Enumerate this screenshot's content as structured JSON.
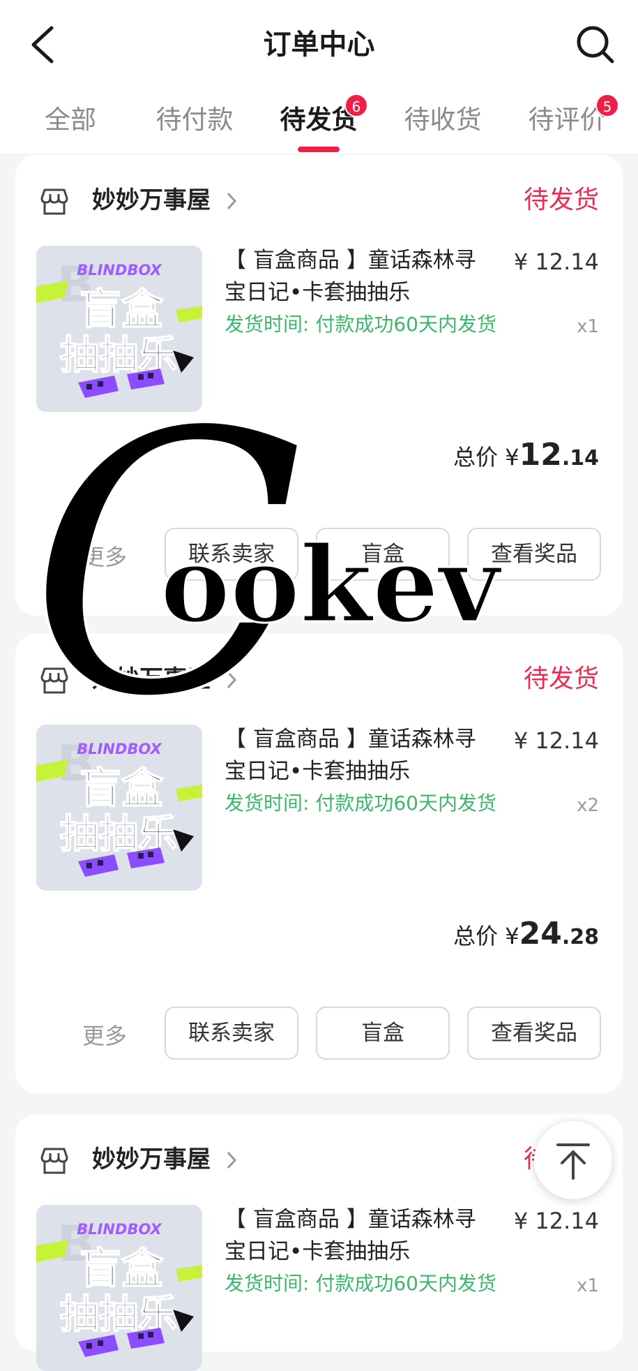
{
  "header": {
    "title": "订单中心"
  },
  "tabs": [
    {
      "label": "全部",
      "badge": ""
    },
    {
      "label": "待付款",
      "badge": ""
    },
    {
      "label": "待发货",
      "badge": "6"
    },
    {
      "label": "待收货",
      "badge": ""
    },
    {
      "label": "待评价",
      "badge": "5"
    }
  ],
  "thumbnail": {
    "brand": "BLINDBOX",
    "line1": "盲盒",
    "line2": "抽抽乐"
  },
  "orders": [
    {
      "shop": "妙妙万事屋",
      "status": "待发货",
      "product_title": "【 盲盒商品 】童话森林寻宝日记•卡套抽抽乐",
      "unit_price": "¥ 12.14",
      "ship_time": "发货时间: 付款成功60天内发货",
      "qty": "x1",
      "total_label": "总价",
      "total_symbol": "¥",
      "total_int": "12",
      "total_dec": ".14",
      "more": "更多",
      "buttons": [
        "联系卖家",
        "盲盒",
        "查看奖品"
      ]
    },
    {
      "shop": "妙妙万事屋",
      "status": "待发货",
      "product_title": "【 盲盒商品 】童话森林寻宝日记•卡套抽抽乐",
      "unit_price": "¥ 12.14",
      "ship_time": "发货时间: 付款成功60天内发货",
      "qty": "x2",
      "total_label": "总价",
      "total_symbol": "¥",
      "total_int": "24",
      "total_dec": ".28",
      "more": "更多",
      "buttons": [
        "联系卖家",
        "盲盒",
        "查看奖品"
      ]
    },
    {
      "shop": "妙妙万事屋",
      "status": "待发货",
      "product_title": "【 盲盒商品 】童话森林寻宝日记•卡套抽抽乐",
      "unit_price": "¥ 12.14",
      "ship_time": "发货时间: 付款成功60天内发货",
      "qty": "x1"
    }
  ],
  "watermark": {
    "big_letter": "C",
    "text": "ookev"
  },
  "colors": {
    "accent": "#e82d55",
    "badge": "#ee2048",
    "ship_green": "#3cb86a",
    "thumb_purple": "#a25bff",
    "thumb_lime": "#c6f23a"
  },
  "icons": {
    "back": "back-arrow-icon",
    "search": "search-icon",
    "shop": "shop-icon",
    "chevron": "chevron-right-icon",
    "scroll_top": "scroll-to-top-icon"
  }
}
